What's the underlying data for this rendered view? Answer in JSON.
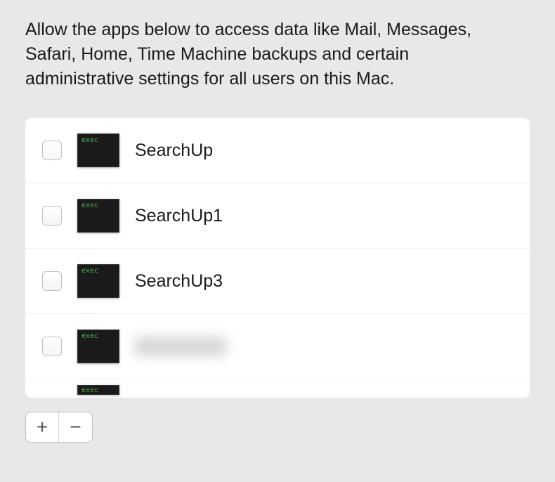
{
  "description": "Allow the apps below to access data like Mail, Messages, Safari, Home, Time Machine backups and certain administrative settings for all users on this Mac.",
  "apps": [
    {
      "name": "SearchUp",
      "checked": false,
      "iconLabel": "exec"
    },
    {
      "name": "SearchUp1",
      "checked": false,
      "iconLabel": "exec"
    },
    {
      "name": "SearchUp3",
      "checked": false,
      "iconLabel": "exec"
    },
    {
      "name": "",
      "checked": false,
      "iconLabel": "exec",
      "blurred": true
    },
    {
      "name": "",
      "checked": false,
      "iconLabel": "exec",
      "partial": true
    }
  ],
  "buttons": {
    "add": "+",
    "remove": "−"
  }
}
